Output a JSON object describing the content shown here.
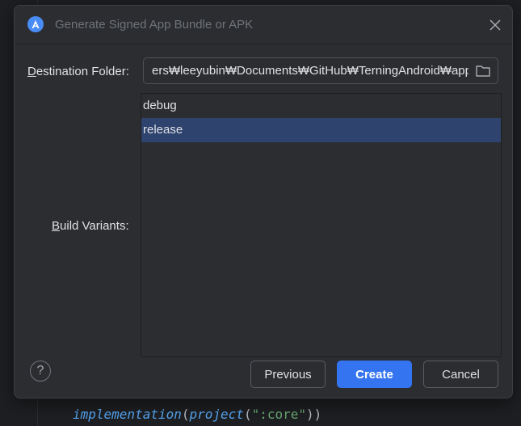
{
  "background_code": {
    "line_fn1": "implementation",
    "line_open1": "(",
    "line_fn2": "project",
    "line_open2": "(",
    "line_str": "\":core\"",
    "line_close": "))"
  },
  "dialog": {
    "title": "Generate Signed App Bundle or APK",
    "destination": {
      "label_mnemonic": "D",
      "label_rest": "estination Folder:",
      "value": "ers₩leeyubin₩Documents₩GitHub₩TerningAndroid₩app"
    },
    "build_variants": {
      "label_mnemonic": "B",
      "label_rest": "uild Variants:",
      "items": [
        {
          "label": "debug",
          "selected": false
        },
        {
          "label": "release",
          "selected": true
        }
      ]
    },
    "help_label": "?",
    "buttons": {
      "previous": "Previous",
      "create": "Create",
      "cancel": "Cancel"
    }
  },
  "colors": {
    "accent": "#3574f0",
    "selection": "#2e436e",
    "dialog_bg": "#2b2d30",
    "ide_bg": "#1e1f22"
  },
  "icons": {
    "app": "android-studio-icon",
    "close": "close-icon",
    "folder": "folder-icon",
    "help": "help-icon"
  }
}
